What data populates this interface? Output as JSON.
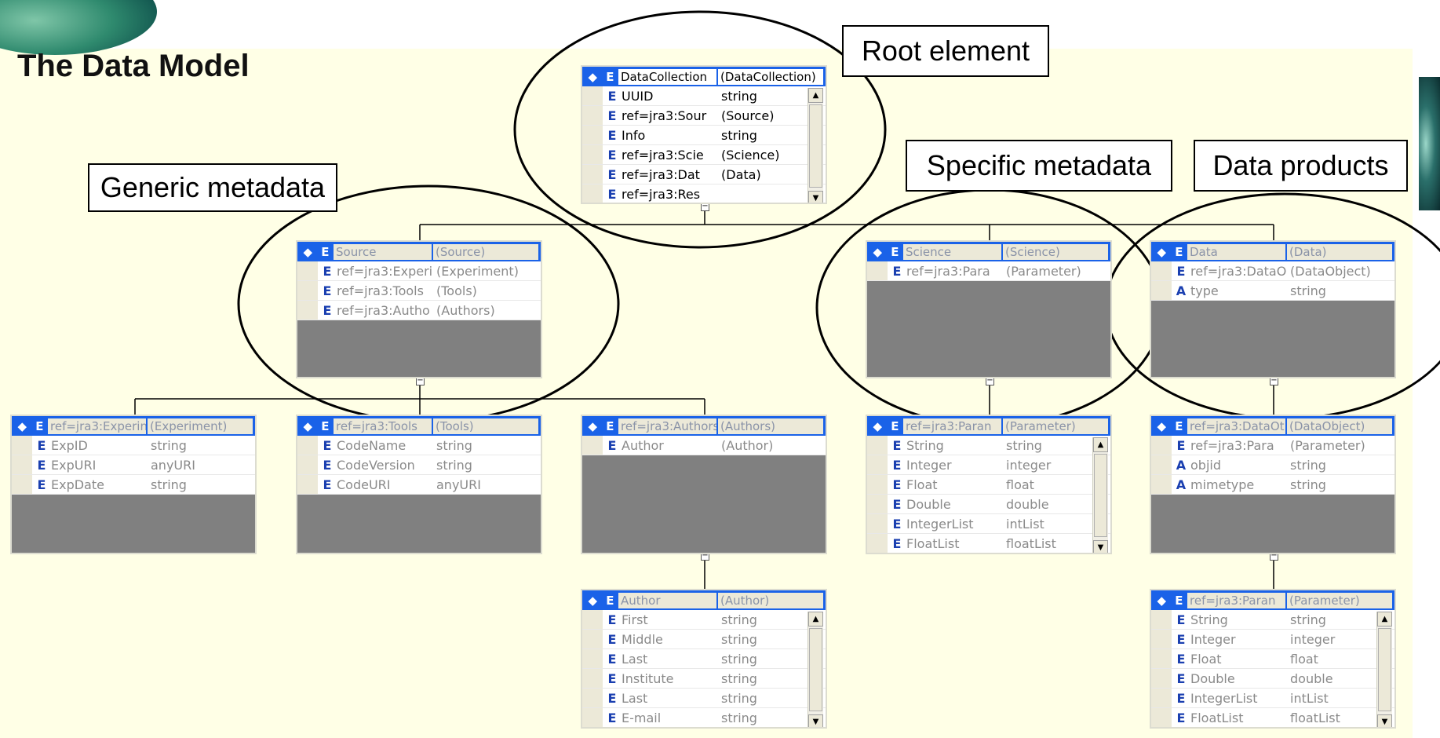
{
  "title": "The Data Model",
  "callouts": {
    "root": "Root element",
    "generic": "Generic metadata",
    "specific": "Specific metadata",
    "products": "Data products"
  },
  "elements": {
    "datacollection": {
      "name": "DataCollection",
      "type": "(DataCollection)",
      "rows": [
        [
          "E",
          "UUID",
          "string"
        ],
        [
          "E",
          "ref=jra3:Sour",
          "(Source)"
        ],
        [
          "E",
          "Info",
          "string"
        ],
        [
          "E",
          "ref=jra3:Scie",
          "(Science)"
        ],
        [
          "E",
          "ref=jra3:Dat",
          "(Data)"
        ],
        [
          "E",
          "ref=jra3:Res",
          ""
        ]
      ]
    },
    "source": {
      "name": "Source",
      "type": "(Source)",
      "rows": [
        [
          "E",
          "ref=jra3:Experi",
          "(Experiment)"
        ],
        [
          "E",
          "ref=jra3:Tools",
          "(Tools)"
        ],
        [
          "E",
          "ref=jra3:Autho",
          "(Authors)"
        ]
      ]
    },
    "science": {
      "name": "Science",
      "type": "(Science)",
      "rows": [
        [
          "E",
          "ref=jra3:Para",
          "(Parameter)"
        ]
      ]
    },
    "data": {
      "name": "Data",
      "type": "(Data)",
      "rows": [
        [
          "E",
          "ref=jra3:DataO",
          "(DataObject)"
        ],
        [
          "A",
          "type",
          "string"
        ]
      ]
    },
    "experiment": {
      "name": "ref=jra3:Experin",
      "type": "(Experiment)",
      "rows": [
        [
          "E",
          "ExpID",
          "string"
        ],
        [
          "E",
          "ExpURI",
          "anyURI"
        ],
        [
          "E",
          "ExpDate",
          "string"
        ]
      ]
    },
    "tools": {
      "name": "ref=jra3:Tools",
      "type": "(Tools)",
      "rows": [
        [
          "E",
          "CodeName",
          "string"
        ],
        [
          "E",
          "CodeVersion",
          "string"
        ],
        [
          "E",
          "CodeURI",
          "anyURI"
        ]
      ]
    },
    "authors": {
      "name": "ref=jra3:Authors",
      "type": "(Authors)",
      "rows": [
        [
          "E",
          "Author",
          "(Author)"
        ]
      ]
    },
    "parameter": {
      "name": "ref=jra3:Paran",
      "type": "(Parameter)",
      "rows": [
        [
          "E",
          "String",
          "string"
        ],
        [
          "E",
          "Integer",
          "integer"
        ],
        [
          "E",
          "Float",
          "float"
        ],
        [
          "E",
          "Double",
          "double"
        ],
        [
          "E",
          "IntegerList",
          "intList"
        ],
        [
          "E",
          "FloatList",
          "floatList"
        ]
      ]
    },
    "dataobject": {
      "name": "ref=jra3:DataOt",
      "type": "(DataObject)",
      "rows": [
        [
          "E",
          "ref=jra3:Para",
          "(Parameter)"
        ],
        [
          "A",
          "objid",
          "string"
        ],
        [
          "A",
          "mimetype",
          "string"
        ]
      ]
    },
    "author": {
      "name": "Author",
      "type": "(Author)",
      "rows": [
        [
          "E",
          "First",
          "string"
        ],
        [
          "E",
          "Middle",
          "string"
        ],
        [
          "E",
          "Last",
          "string"
        ],
        [
          "E",
          "Institute",
          "string"
        ],
        [
          "E",
          "Last",
          "string"
        ],
        [
          "E",
          "E-mail",
          "string"
        ]
      ]
    },
    "parameter2": {
      "name": "ref=jra3:Paran",
      "type": "(Parameter)",
      "rows": [
        [
          "E",
          "String",
          "string"
        ],
        [
          "E",
          "Integer",
          "integer"
        ],
        [
          "E",
          "Float",
          "float"
        ],
        [
          "E",
          "Double",
          "double"
        ],
        [
          "E",
          "IntegerList",
          "intList"
        ],
        [
          "E",
          "FloatList",
          "floatList"
        ]
      ]
    }
  },
  "icons": {
    "diamond": "◆",
    "minus": "⊟",
    "up": "▲",
    "down": "▼"
  }
}
